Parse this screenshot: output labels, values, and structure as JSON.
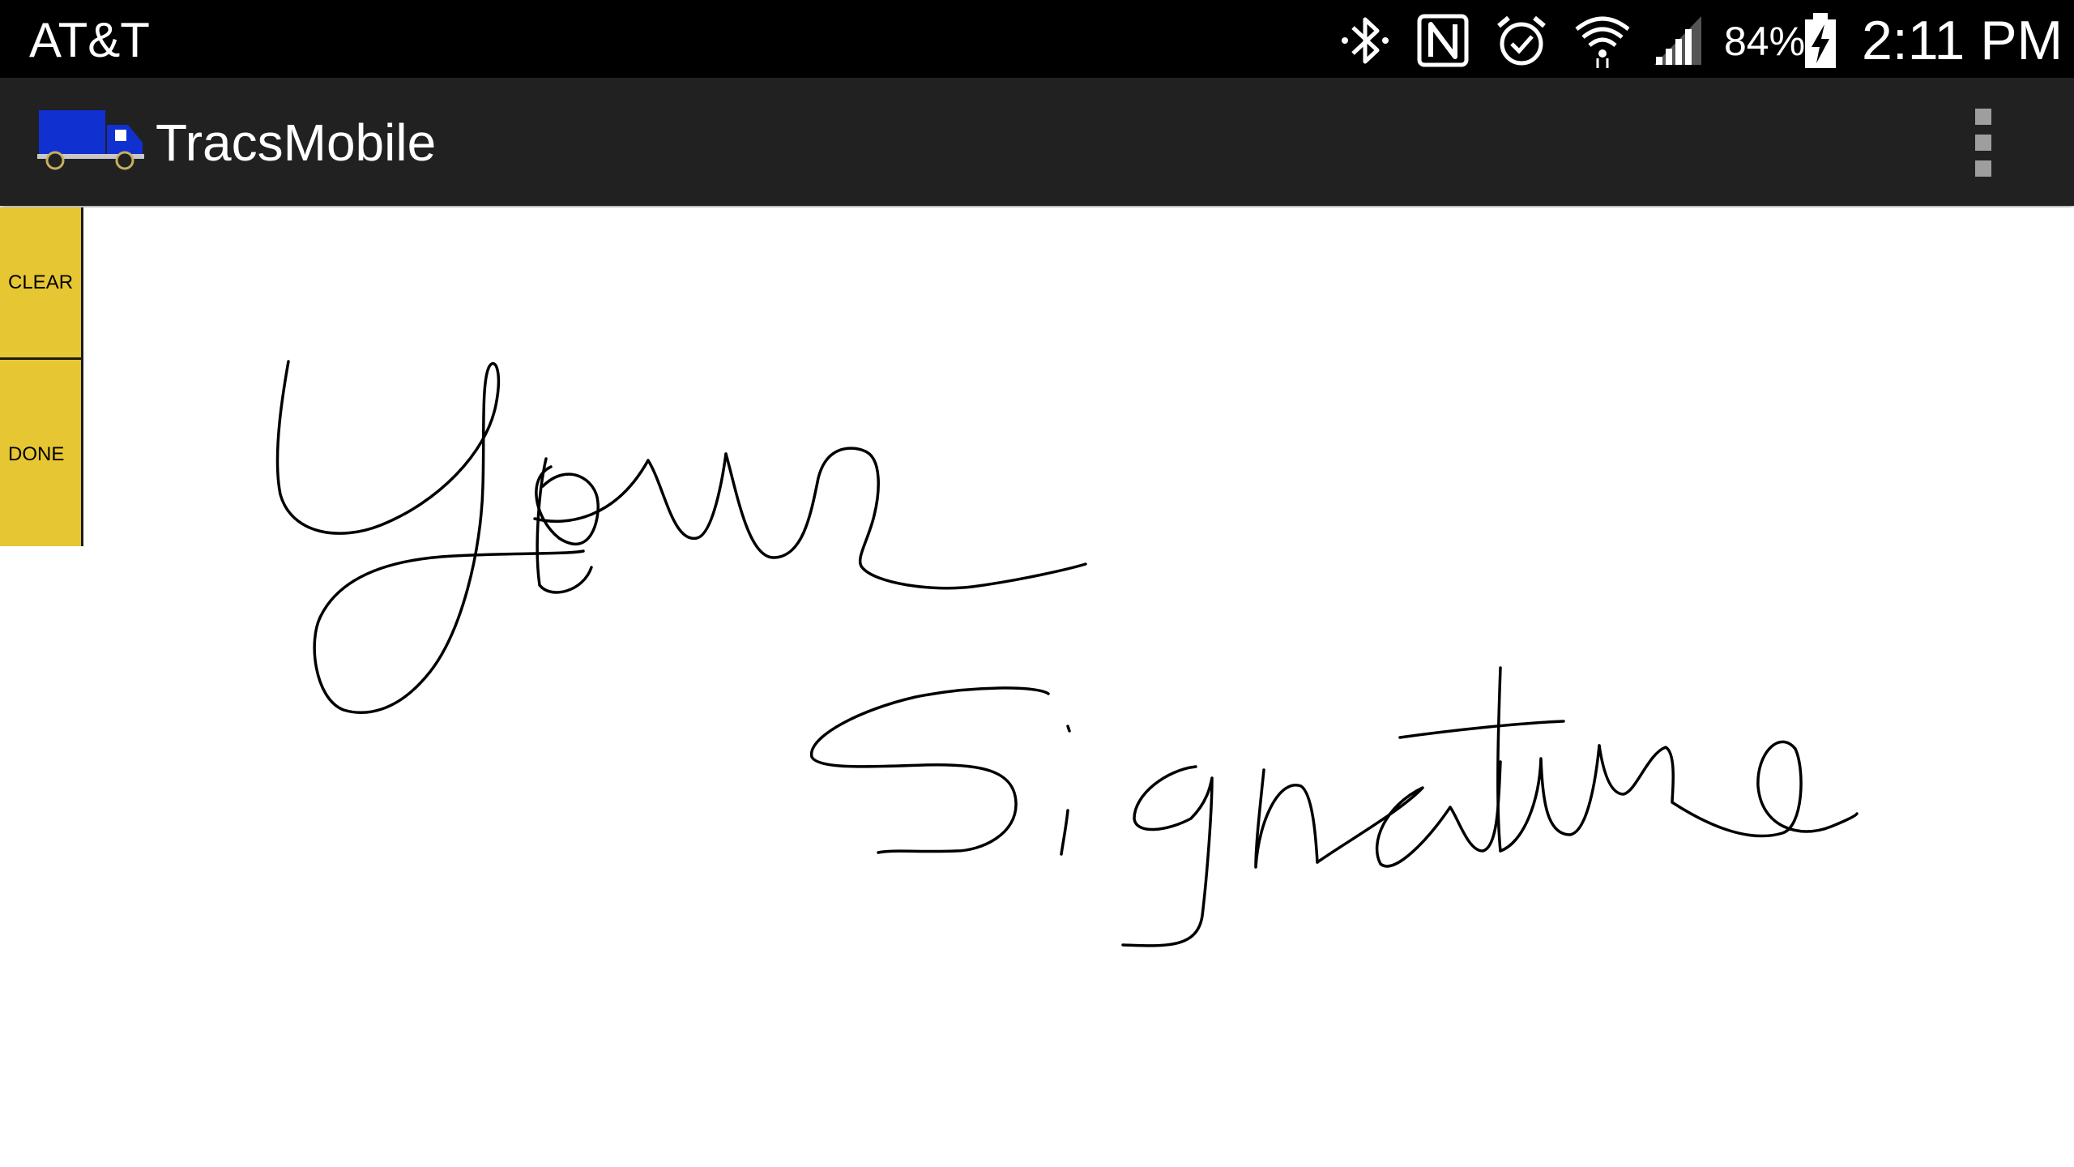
{
  "status_bar": {
    "carrier": "AT&T",
    "battery_percent": "84%",
    "time": "2:11 PM",
    "icons": [
      "bluetooth-icon",
      "nfc-icon",
      "alarm-icon",
      "wifi-icon",
      "signal-icon",
      "battery-charging-icon"
    ]
  },
  "action_bar": {
    "title": "TracsMobile",
    "logo": "truck-icon",
    "overflow": "overflow-menu-icon"
  },
  "side_buttons": {
    "clear_label": "CLEAR",
    "done_label": "DONE"
  },
  "colors": {
    "status_bar": "#000000",
    "action_bar": "#212121",
    "button_yellow": "#e6c633",
    "truck_blue": "#1030d0",
    "ink": "#000000"
  }
}
